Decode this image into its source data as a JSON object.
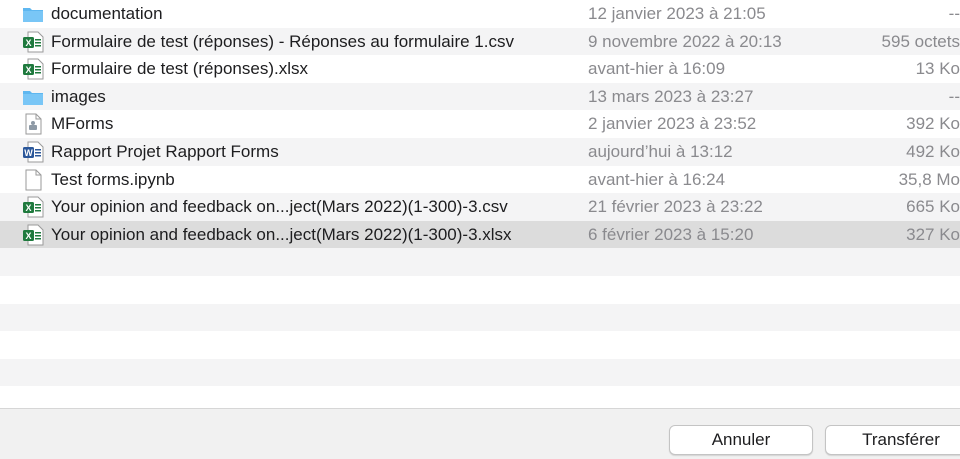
{
  "files": [
    {
      "icon": "folder",
      "name": "documentation",
      "date": "12 janvier 2023 à 21:05",
      "size": "--"
    },
    {
      "icon": "excel",
      "name": "Formulaire de test (réponses) - Réponses au formulaire 1.csv",
      "date": "9 novembre 2022 à 20:13",
      "size": "595 octets"
    },
    {
      "icon": "excel",
      "name": "Formulaire de test (réponses).xlsx",
      "date": "avant-hier à 16:09",
      "size": "13 Ko"
    },
    {
      "icon": "folder",
      "name": "images",
      "date": "13 mars 2023 à 23:27",
      "size": "--"
    },
    {
      "icon": "generic",
      "name": "MForms",
      "date": "2 janvier 2023 à 23:52",
      "size": "392 Ko"
    },
    {
      "icon": "word",
      "name": "Rapport Projet Rapport Forms",
      "date": "aujourd’hui à 13:12",
      "size": "492 Ko"
    },
    {
      "icon": "doc",
      "name": "Test forms.ipynb",
      "date": "avant-hier à 16:24",
      "size": "35,8 Mo"
    },
    {
      "icon": "excel",
      "name": "Your opinion  and feedback on...ject(Mars 2022)(1-300)-3.csv",
      "date": "21 février 2023 à 23:22",
      "size": "665 Ko"
    },
    {
      "icon": "excel",
      "name": "Your opinion  and feedback on...ject(Mars 2022)(1-300)-3.xlsx",
      "date": "6 février 2023 à 15:20",
      "size": "327 Ko",
      "selected": true
    }
  ],
  "footer": {
    "cancel_label": "Annuler",
    "transfer_label": "Transférer"
  },
  "colors": {
    "selected_row": "#dcdcdc",
    "alt_row": "#f4f4f5",
    "folder": "#5eb7f0",
    "excel": "#1f7a3e",
    "word": "#2b579a"
  }
}
